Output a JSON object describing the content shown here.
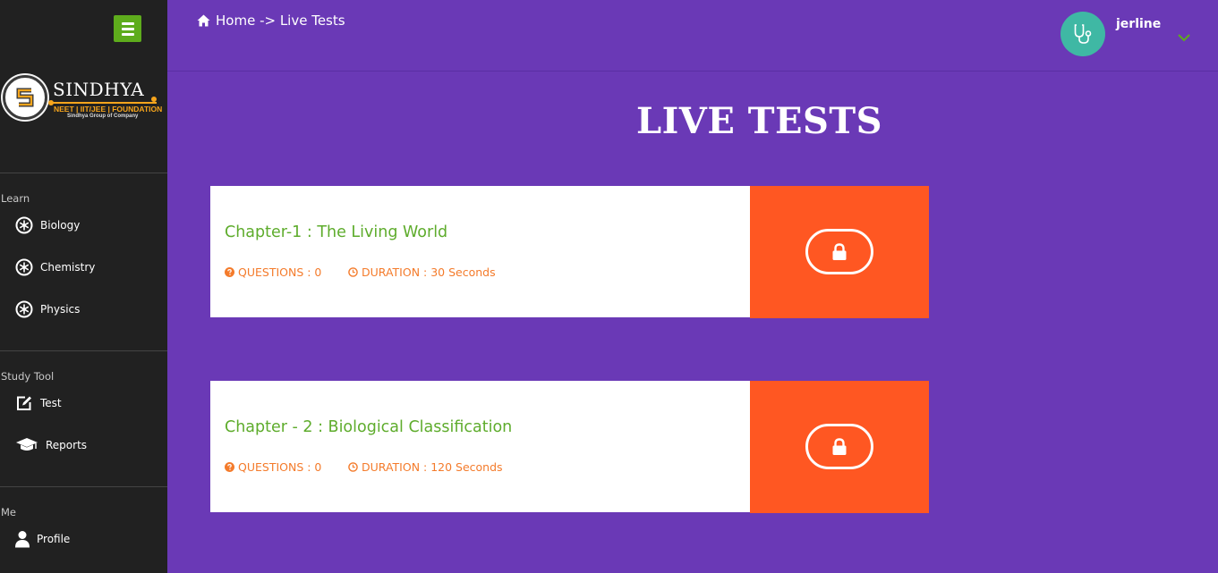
{
  "sidebar": {
    "logo": {
      "name": "SINDHYA",
      "tagline": "NEET | IIT/JEE | FOUNDATION",
      "subtitle": "Sindhya Group of Company"
    },
    "sections": [
      {
        "label": "Learn",
        "items": [
          {
            "label": "Biology",
            "icon": "atom-icon"
          },
          {
            "label": "Chemistry",
            "icon": "atom-icon"
          },
          {
            "label": "Physics",
            "icon": "atom-icon"
          }
        ]
      },
      {
        "label": "Study Tool",
        "items": [
          {
            "label": "Test",
            "icon": "edit-icon"
          },
          {
            "label": "Reports",
            "icon": "graduation-cap-icon"
          }
        ]
      },
      {
        "label": "Me",
        "items": [
          {
            "label": "Profile",
            "icon": "user-icon"
          }
        ]
      }
    ]
  },
  "header": {
    "breadcrumb": "Home -> Live Tests",
    "user": {
      "name": "jerline",
      "avatar_icon": "stethoscope-icon"
    }
  },
  "page": {
    "title": "LIVE TESTS"
  },
  "tests": [
    {
      "title": "Chapter-1 : The Living World",
      "questions": "QUESTIONS : 0",
      "duration": "DURATION : 30 Seconds",
      "action_icon": "lock-icon"
    },
    {
      "title": "Chapter - 2 : Biological Classification",
      "questions": "QUESTIONS : 0",
      "duration": "DURATION : 120 Seconds",
      "action_icon": "lock-icon"
    }
  ],
  "colors": {
    "background": "#6a39b6",
    "sidebar": "#212121",
    "menu_button": "#5eac1c",
    "card_title": "#5eac2c",
    "meta_text": "#f47b2b",
    "action_panel": "#ff5722",
    "avatar": "#3fb8a4",
    "logo_accent": "#f7a51c"
  }
}
